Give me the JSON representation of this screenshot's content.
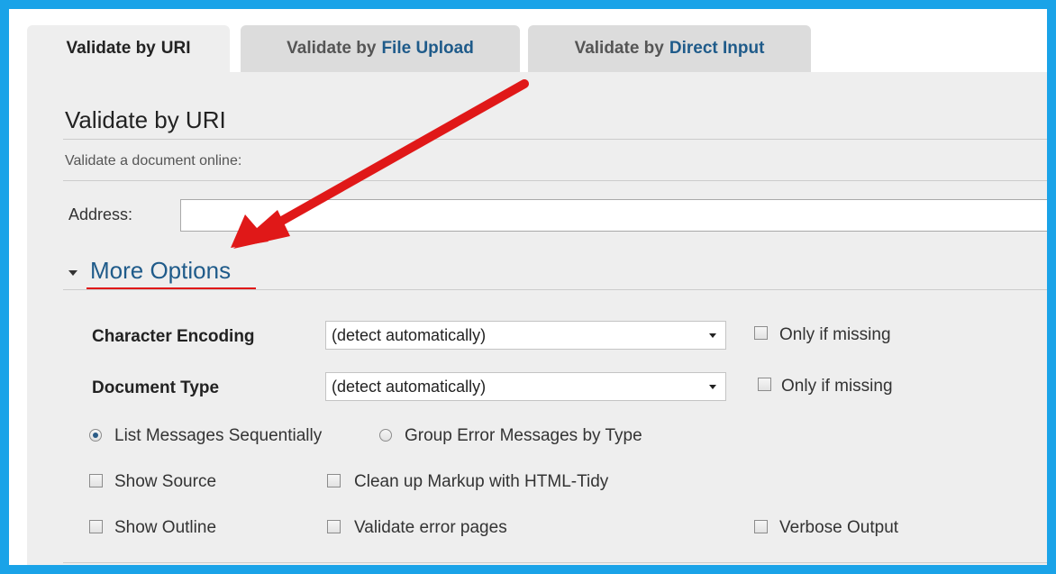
{
  "tabs": [
    {
      "prefix": "Validate by",
      "highlight": "URI",
      "active": true
    },
    {
      "prefix": "Validate by",
      "highlight": "File Upload",
      "active": false
    },
    {
      "prefix": "Validate by",
      "highlight": "Direct Input",
      "active": false
    }
  ],
  "section": {
    "title": "Validate by URI",
    "subtitle": "Validate a document online:"
  },
  "address": {
    "label": "Address:",
    "value": "",
    "placeholder": ""
  },
  "more_options": {
    "label": "More Options",
    "expanded": true
  },
  "options": {
    "encoding": {
      "label": "Character Encoding",
      "selected": "(detect automatically)",
      "only_if_missing": "Only if missing"
    },
    "doctype": {
      "label": "Document Type",
      "selected": "(detect automatically)",
      "only_if_missing": "Only if missing"
    },
    "radio_sequential": {
      "label": "List Messages Sequentially",
      "checked": true
    },
    "radio_group": {
      "label": "Group Error Messages by Type",
      "checked": false
    },
    "show_source": "Show Source",
    "cleanup": "Clean up Markup with HTML-Tidy",
    "show_outline": "Show Outline",
    "validate_errors": "Validate error pages",
    "verbose": "Verbose Output"
  },
  "colors": {
    "frame_border": "#1aa3e8",
    "annotation_arrow": "#e01818",
    "link_blue": "#1f5b8a"
  },
  "icons": {
    "expand_icon": "triangle-down-icon",
    "select_arrow": "chevron-down-icon",
    "annotation": "red-arrow-icon"
  }
}
